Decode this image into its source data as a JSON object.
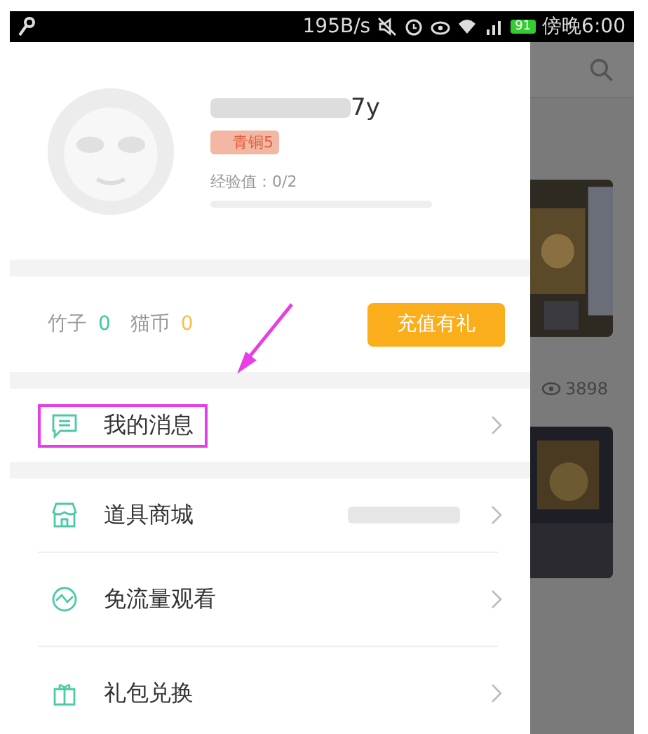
{
  "status_bar": {
    "speed": "195B/s",
    "battery": "91",
    "time": "傍晚6:00"
  },
  "profile": {
    "name": "7y",
    "badge": "青铜5",
    "exp": "经验值：0/2",
    "level": 0
  },
  "wallet": [
    {
      "label": "竹子",
      "value": "0",
      "color": "#3cc9a0"
    },
    {
      "label": "猫币",
      "value": "0",
      "color": "#f5c04a"
    }
  ],
  "recharge_button": "充值有礼",
  "menu": [
    {
      "kind": "message",
      "label": "我的消息",
      "highlighted": true,
      "blurred_value": false
    },
    {
      "kind": "shop",
      "label": "道具商城",
      "highlighted": false,
      "blurred_value": true
    },
    {
      "kind": "wave",
      "label": "免流量观看",
      "highlighted": false,
      "blurred_value": false
    },
    {
      "kind": "gift",
      "label": "礼包兑换",
      "highlighted": false,
      "blurred_value": false
    }
  ],
  "background": {
    "views": "3898"
  }
}
